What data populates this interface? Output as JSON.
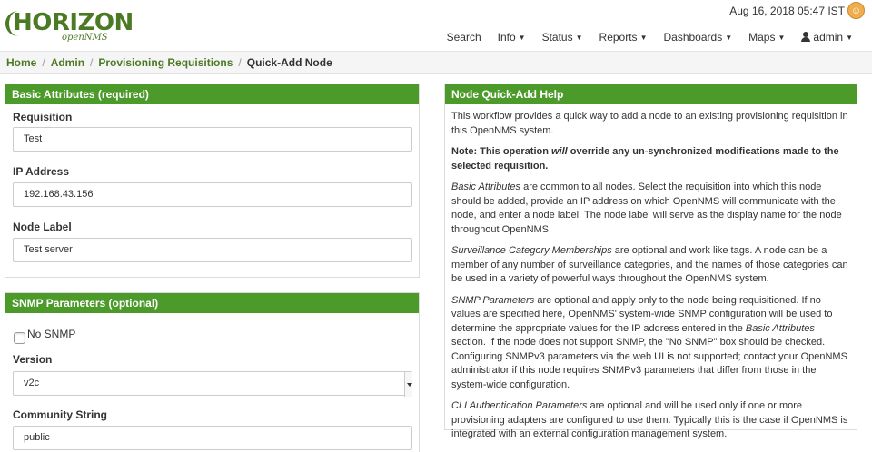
{
  "header": {
    "logo_main": "HORIZON",
    "logo_sub": "openNMS",
    "datetime": "Aug 16, 2018 05:47 IST",
    "nav": [
      {
        "label": "Search",
        "has_caret": false
      },
      {
        "label": "Info",
        "has_caret": true
      },
      {
        "label": "Status",
        "has_caret": true
      },
      {
        "label": "Reports",
        "has_caret": true
      },
      {
        "label": "Dashboards",
        "has_caret": true
      },
      {
        "label": "Maps",
        "has_caret": true
      }
    ],
    "user_label": "admin"
  },
  "breadcrumb": {
    "items": [
      "Home",
      "Admin",
      "Provisioning Requisitions"
    ],
    "current": "Quick-Add Node"
  },
  "basic": {
    "title": "Basic Attributes (required)",
    "requisition_label": "Requisition",
    "requisition_value": "Test",
    "ip_label": "IP Address",
    "ip_value": "192.168.43.156",
    "node_label_label": "Node Label",
    "node_label_value": "Test server"
  },
  "snmp": {
    "title": "SNMP Parameters (optional)",
    "no_snmp_label": "No SNMP",
    "no_snmp_checked": false,
    "version_label": "Version",
    "version_value": "v2c",
    "community_label": "Community String",
    "community_value": "public"
  },
  "help": {
    "title": "Node Quick-Add Help",
    "p1": "This workflow provides a quick way to add a node to an existing provisioning requisition in this OpenNMS system.",
    "note_a": "Note: This operation ",
    "note_em": "will",
    "note_b": " override any un-synchronized modifications made to the selected requisition.",
    "p3_em": "Basic Attributes",
    "p3": " are common to all nodes. Select the requisition into which this node should be added, provide an IP address on which OpenNMS will communicate with the node, and enter a node label. The node label will serve as the display name for the node throughout OpenNMS.",
    "p4_em": "Surveillance Category Memberships",
    "p4": " are optional and work like tags. A node can be a member of any number of surveillance categories, and the names of those categories can be used in a variety of powerful ways throughout the OpenNMS system.",
    "p5_em": "SNMP Parameters",
    "p5a": " are optional and apply only to the node being requisitioned. If no values are specified here, OpenNMS' system-wide SNMP configuration will be used to determine the appropriate values for the IP address entered in the ",
    "p5_em2": "Basic Attributes",
    "p5b": " section. If the node does not support SNMP, the \"No SNMP\" box should be checked. Configuring SNMPv3 parameters via the web UI is not supported; contact your OpenNMS administrator if this node requires SNMPv3 parameters that differ from those in the system-wide configuration.",
    "p6_em": "CLI Authentication Parameters",
    "p6": " are optional and will be used only if one or more provisioning adapters are configured to use them. Typically this is the case if OpenNMS is integrated with an external configuration management system."
  },
  "colors": {
    "panel_header": "#4c9a2a",
    "link": "#4b7a25",
    "avatar": "#f0ad4e"
  }
}
